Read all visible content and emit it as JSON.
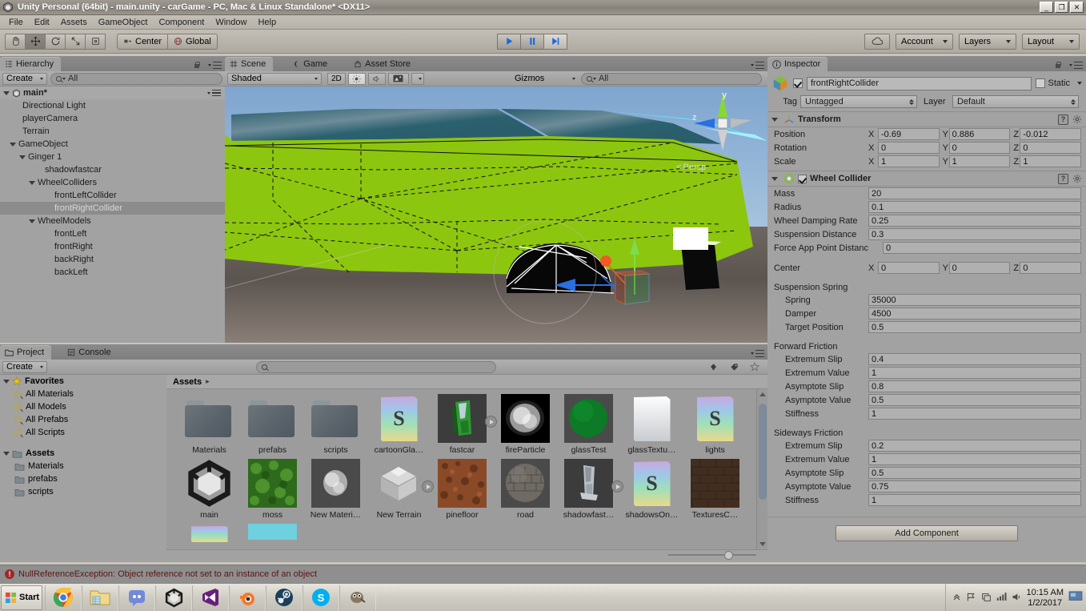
{
  "window": {
    "title": "Unity Personal (64bit) - main.unity - carGame - PC, Mac & Linux Standalone* <DX11>",
    "minimize_label": "_",
    "restore_label": "❐",
    "close_label": "✕"
  },
  "menubar": {
    "items": [
      "File",
      "Edit",
      "Assets",
      "GameObject",
      "Component",
      "Window",
      "Help"
    ]
  },
  "toolbar": {
    "transform_tools": [
      "hand-tool",
      "move-tool",
      "rotate-tool",
      "scale-tool",
      "rect-tool"
    ],
    "pivot_mode": "Center",
    "pivot_rotation": "Global",
    "play": "play-button",
    "pause": "pause-button",
    "step": "step-button",
    "cloud": "cloud-button",
    "account": "Account",
    "layers": "Layers",
    "layout": "Layout"
  },
  "hierarchy": {
    "tab": "Hierarchy",
    "create": "Create",
    "search_placeholder": "All",
    "search_value": "All",
    "scene_root": "main*",
    "items": [
      {
        "label": "Directional Light",
        "depth": 1,
        "arrow": "none",
        "selected": false
      },
      {
        "label": "playerCamera",
        "depth": 1,
        "arrow": "none",
        "selected": false
      },
      {
        "label": "Terrain",
        "depth": 1,
        "arrow": "none",
        "selected": false
      },
      {
        "label": "GameObject",
        "depth": 1,
        "arrow": "open",
        "selected": false
      },
      {
        "label": "Ginger 1",
        "depth": 2,
        "arrow": "open",
        "selected": false
      },
      {
        "label": "shadowfastcar",
        "depth": 3,
        "arrow": "none",
        "selected": false
      },
      {
        "label": "WheelColliders",
        "depth": 3,
        "arrow": "open",
        "selected": false
      },
      {
        "label": "frontLeftCollider",
        "depth": 4,
        "arrow": "none",
        "selected": false
      },
      {
        "label": "frontRightCollider",
        "depth": 4,
        "arrow": "none",
        "selected": true
      },
      {
        "label": "WheelModels",
        "depth": 3,
        "arrow": "open",
        "selected": false
      },
      {
        "label": "frontLeft",
        "depth": 4,
        "arrow": "none",
        "selected": false
      },
      {
        "label": "frontRight",
        "depth": 4,
        "arrow": "none",
        "selected": false
      },
      {
        "label": "backRight",
        "depth": 4,
        "arrow": "none",
        "selected": false
      },
      {
        "label": "backLeft",
        "depth": 4,
        "arrow": "none",
        "selected": false
      }
    ]
  },
  "scene_view": {
    "tabs": [
      {
        "label": "Scene",
        "icon": "grid-icon",
        "active": true
      },
      {
        "label": "Game",
        "icon": "gamepad-icon",
        "active": false
      },
      {
        "label": "Asset Store",
        "icon": "store-icon",
        "active": false
      }
    ],
    "draw_mode": "Shaded",
    "mode_2d": "2D",
    "lighting_toggle": "lighting-icon",
    "audio_toggle": "audio-icon",
    "effects_toggle": "effects-icon",
    "gizmos": "Gizmos",
    "search_placeholder": "All",
    "search_value": "All",
    "axis_gizmo": {
      "y": "y",
      "z": "z",
      "projection": "Persp"
    }
  },
  "inspector": {
    "tab": "Inspector",
    "object_name": "frontRightCollider",
    "enabled": true,
    "static_label": "Static",
    "tag_label": "Tag",
    "tag_value": "Untagged",
    "layer_label": "Layer",
    "layer_value": "Default",
    "components": [
      {
        "name": "Transform",
        "icon": "transform-icon",
        "vectors": [
          {
            "label": "Position",
            "x": "-0.69",
            "y": "0.886",
            "z": "-0.012"
          },
          {
            "label": "Rotation",
            "x": "0",
            "y": "0",
            "z": "0"
          },
          {
            "label": "Scale",
            "x": "1",
            "y": "1",
            "z": "1"
          }
        ]
      },
      {
        "name": "Wheel Collider",
        "icon": "wheel-collider-icon",
        "enabled": true,
        "fields": [
          {
            "label": "Mass",
            "value": "20"
          },
          {
            "label": "Radius",
            "value": "0.1"
          },
          {
            "label": "Wheel Damping Rate",
            "value": "0.25"
          },
          {
            "label": "Suspension Distance",
            "value": "0.3"
          },
          {
            "label": "Force App Point Distanc",
            "value": "0"
          }
        ],
        "center": {
          "label": "Center",
          "x": "0",
          "y": "0",
          "z": "0"
        },
        "groups": [
          {
            "title": "Suspension Spring",
            "fields": [
              {
                "label": "Spring",
                "value": "35000"
              },
              {
                "label": "Damper",
                "value": "4500"
              },
              {
                "label": "Target Position",
                "value": "0.5"
              }
            ]
          },
          {
            "title": "Forward Friction",
            "fields": [
              {
                "label": "Extremum Slip",
                "value": "0.4"
              },
              {
                "label": "Extremum Value",
                "value": "1"
              },
              {
                "label": "Asymptote Slip",
                "value": "0.8"
              },
              {
                "label": "Asymptote Value",
                "value": "0.5"
              },
              {
                "label": "Stiffness",
                "value": "1"
              }
            ]
          },
          {
            "title": "Sideways Friction",
            "fields": [
              {
                "label": "Extremum Slip",
                "value": "0.2"
              },
              {
                "label": "Extremum Value",
                "value": "1"
              },
              {
                "label": "Asymptote Slip",
                "value": "0.5"
              },
              {
                "label": "Asymptote Value",
                "value": "0.75"
              },
              {
                "label": "Stiffness",
                "value": "1"
              }
            ]
          }
        ]
      }
    ],
    "add_component": "Add Component"
  },
  "project": {
    "tabs": [
      {
        "label": "Project",
        "icon": "folder-icon",
        "active": true
      },
      {
        "label": "Console",
        "icon": "console-icon",
        "active": false
      }
    ],
    "create": "Create",
    "search_value": "",
    "favorites_label": "Favorites",
    "favorites": [
      "All Materials",
      "All Models",
      "All Prefabs",
      "All Scripts"
    ],
    "assets_label": "Assets",
    "folders": [
      "Materials",
      "prefabs",
      "scripts"
    ],
    "breadcrumb": "Assets",
    "grid": [
      {
        "label": "Materials",
        "kind": "folder"
      },
      {
        "label": "prefabs",
        "kind": "folder"
      },
      {
        "label": "scripts",
        "kind": "folder"
      },
      {
        "label": "cartoonGla…",
        "kind": "script"
      },
      {
        "label": "fastcar",
        "kind": "model-green",
        "badge": true
      },
      {
        "label": "fireParticle",
        "kind": "texture-smoke"
      },
      {
        "label": "glassTest",
        "kind": "material-green"
      },
      {
        "label": "glassTextu…",
        "kind": "texture-white"
      },
      {
        "label": "lights",
        "kind": "script"
      },
      {
        "label": "main",
        "kind": "unity-scene"
      },
      {
        "label": "moss",
        "kind": "texture-moss"
      },
      {
        "label": "New Materi…",
        "kind": "material-smoke"
      },
      {
        "label": "New Terrain",
        "kind": "terrain",
        "badge": true
      },
      {
        "label": "pinefloor",
        "kind": "texture-pine"
      },
      {
        "label": "road",
        "kind": "material-road"
      },
      {
        "label": "shadowfast…",
        "kind": "model-grey",
        "badge": true
      },
      {
        "label": "shadowsOn…",
        "kind": "script"
      },
      {
        "label": "TexturesC…",
        "kind": "texture-brick"
      }
    ]
  },
  "status": {
    "message": "NullReferenceException: Object reference not set to an instance of an object",
    "icon": "error-icon"
  },
  "taskbar": {
    "start": "Start",
    "apps": [
      "chrome-icon",
      "explorer-icon",
      "discord-icon",
      "unity-icon",
      "visual-studio-icon",
      "blender-icon",
      "steam-icon",
      "skype-icon",
      "gimp-icon"
    ],
    "tray_icons": [
      "show-hidden-icon",
      "flag-icon",
      "action-center-icon",
      "network-icon",
      "volume-icon"
    ],
    "time": "10:15 AM",
    "date": "1/2/2017",
    "show_desktop": "show-desktop-button"
  },
  "colors": {
    "car_green": "#8dc60f",
    "glass_teal": "#2e6470",
    "sky": "#8fb4d6",
    "ground": "#4a4441",
    "accent_blue": "#2a6ee0",
    "error_red": "#5c1414",
    "selection": "#8c8c8c"
  }
}
